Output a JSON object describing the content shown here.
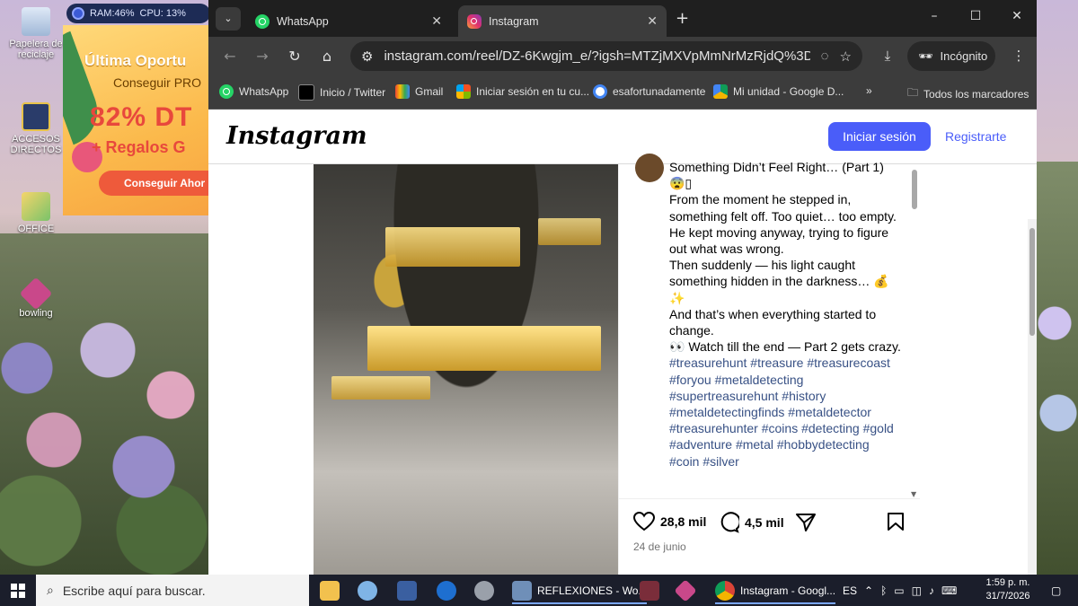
{
  "desktop": {
    "icons": [
      {
        "label": "Papelera de reciclaje"
      },
      {
        "label": "ACCESOS DIRECTOS"
      },
      {
        "label": "OFFICE"
      },
      {
        "label": "bowling"
      }
    ],
    "sysmon": {
      "ram": "RAM:46%",
      "cpu": "CPU: 13%"
    },
    "promo": {
      "title": "Última Oportu",
      "subtitle": "Conseguir PRO",
      "discount": "82% DT",
      "gifts": "+ Regalos G",
      "button": "Conseguir Ahor"
    }
  },
  "browser": {
    "tabs": [
      {
        "title": "WhatsApp",
        "active": false
      },
      {
        "title": "Instagram",
        "active": true
      }
    ],
    "address": "instagram.com/reel/DZ-6Kwgjm_e/?igsh=MTZjMXVpMmNrMzRjdQ%3D...",
    "incognito_label": "Incógnito",
    "bookmarks": [
      {
        "label": "WhatsApp"
      },
      {
        "label": "Inicio / Twitter"
      },
      {
        "label": "Gmail"
      },
      {
        "label": "Iniciar sesión en tu cu..."
      },
      {
        "label": "esafortunadamente"
      },
      {
        "label": "Mi unidad - Google D..."
      }
    ],
    "bookmarks_more": "»",
    "all_bookmarks": "Todos los marcadores"
  },
  "instagram": {
    "logo": "Instagram",
    "login_button": "Iniciar sesión",
    "signup_link": "Registrarte",
    "caption_lines": [
      "Something Didn’t Feel Right… (Part 1)",
      "😨▯",
      "From the moment he stepped in, something felt off. Too quiet… too empty.",
      "He kept moving anyway, trying to figure out what was wrong.",
      "Then suddenly — his light caught something hidden in the darkness… 💰✨",
      "And that’s when everything started to change.",
      "👀 Watch till the end — Part 2 gets crazy."
    ],
    "hashtags": "#treasurehunt #treasure #treasurecoast #foryou #metaldetecting #supertreasurehunt #history #metaldetectingfinds #metaldetector #treasurehunter #coins #detecting #gold #adventure #metal #hobbydetecting #coin #silver",
    "likes": "28,8 mil",
    "comments": "4,5 mil",
    "date": "24 de junio"
  },
  "taskbar": {
    "search_placeholder": "Escribe aquí para buscar.",
    "apps": [
      {
        "label": "REFLEXIONES - Wo..."
      },
      {
        "label": "Instagram - Googl..."
      }
    ],
    "lang": "ES",
    "time": "1:59 p. m.",
    "date": "31/7/2026"
  },
  "colors": {
    "ig_blue": "#4a5df9",
    "hashtag": "#385185",
    "chrome_dark": "#1f1f1f",
    "taskbar": "#1b1e2b"
  }
}
